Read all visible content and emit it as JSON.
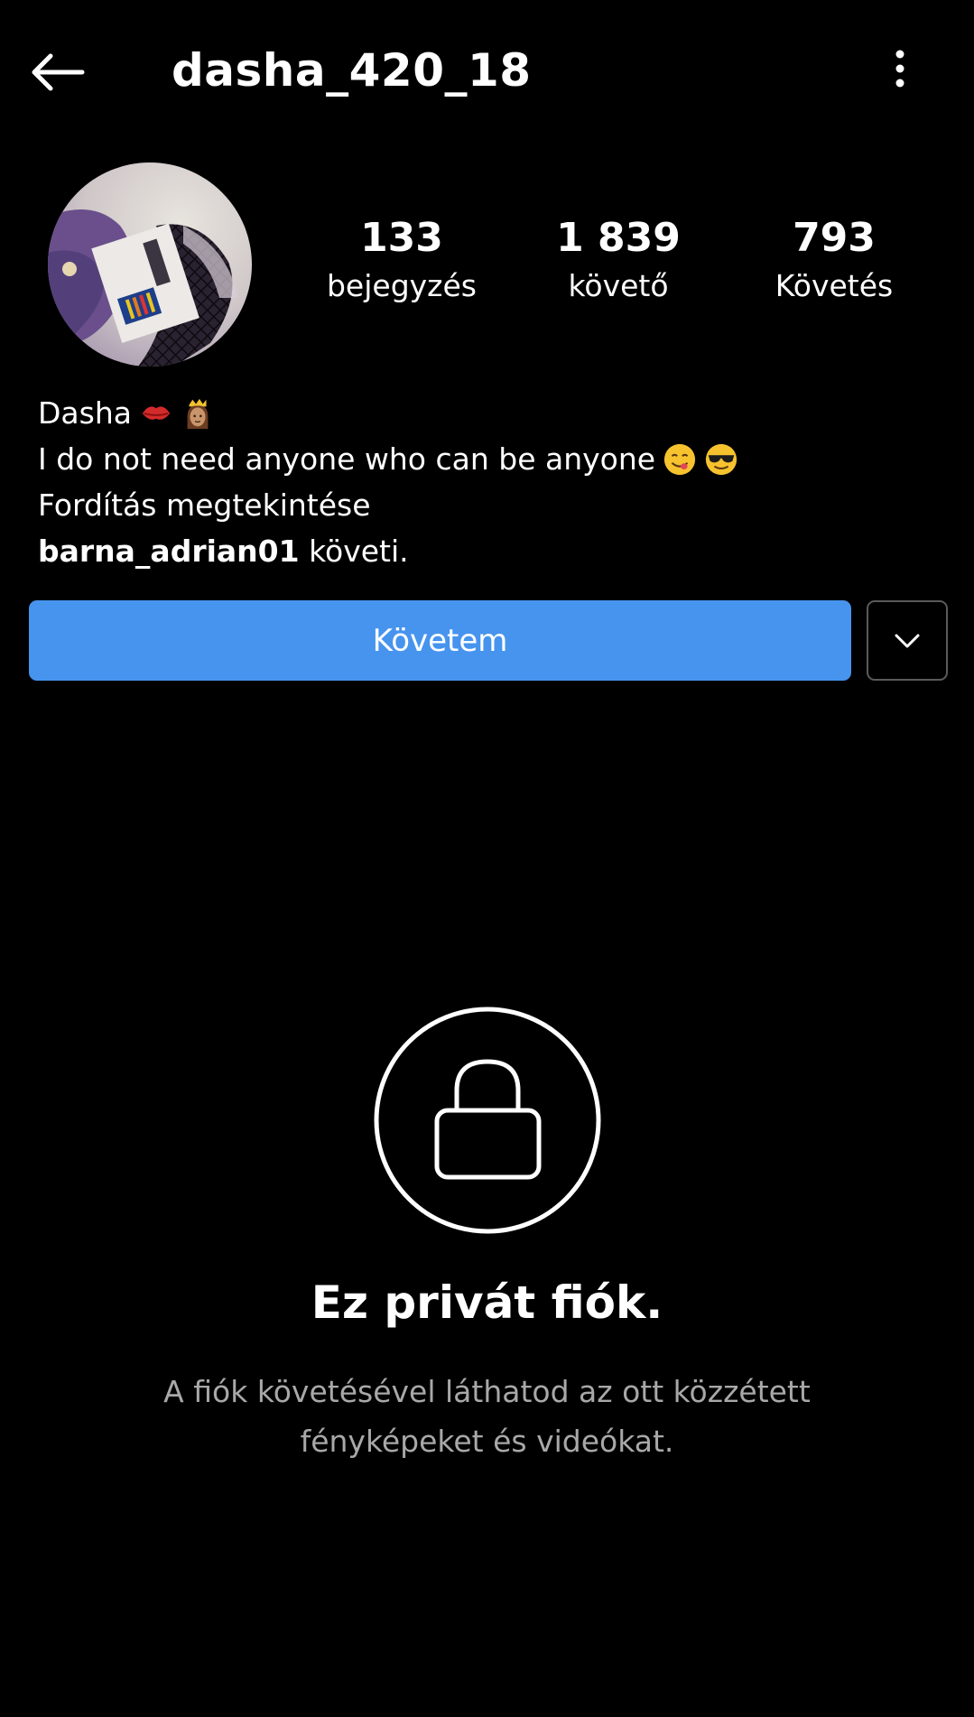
{
  "header": {
    "username": "dasha_420_18",
    "back_icon": "arrow-left-icon",
    "more_icon": "more-vertical-icon"
  },
  "profile": {
    "avatar_icon": "profile-photo",
    "stats": [
      {
        "value": "133",
        "label": "bejegyzés"
      },
      {
        "value": "1 839",
        "label": "követő"
      },
      {
        "value": "793",
        "label": "Követés"
      }
    ]
  },
  "bio": {
    "name": "Dasha",
    "name_emojis": [
      "kiss-mark-icon",
      "princess-icon"
    ],
    "text": "I do not need anyone who can be anyone",
    "text_emojis": [
      "face-savoring-food-icon",
      "smiling-face-with-sunglasses-icon"
    ],
    "translate_link": "Fordítás megtekintése",
    "followed_by_user": "barna_adrian01",
    "followed_by_suffix": " követi."
  },
  "actions": {
    "follow_label": "Követem",
    "dropdown_icon": "chevron-down-icon"
  },
  "private": {
    "icon": "lock-icon",
    "title": "Ez privát fiók.",
    "description": "A fiók követésével láthatod az ott közzétett fényképeket és videókat."
  },
  "colors": {
    "background": "#000000",
    "follow_button": "#4794ee",
    "muted_text": "#a8a8a8"
  }
}
